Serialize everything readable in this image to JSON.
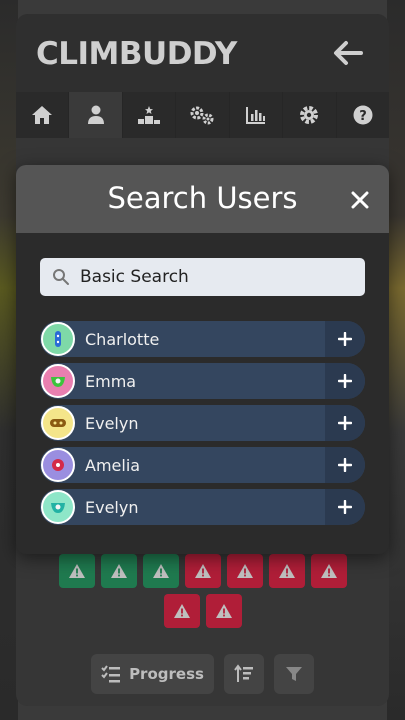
{
  "app": {
    "logo": "CLIMBUDDY"
  },
  "header": {
    "back_icon": "arrow-left-icon"
  },
  "nav": {
    "tabs": [
      {
        "icon": "home-icon"
      },
      {
        "icon": "user-icon",
        "active": true
      },
      {
        "icon": "leaderboard-icon"
      },
      {
        "icon": "gears-icon"
      },
      {
        "icon": "stats-chart-icon"
      },
      {
        "icon": "settings-icon"
      },
      {
        "icon": "help-icon"
      }
    ]
  },
  "modal": {
    "title": "Search Users",
    "close_icon": "close-icon",
    "search": {
      "value": "Basic Search",
      "icon": "search-icon"
    },
    "users": [
      {
        "name": "Charlotte",
        "avatar_color": "#7ed9a8",
        "inner_color": "#2a6bd6"
      },
      {
        "name": "Emma",
        "avatar_color": "#e97fb0",
        "inner_color": "#3cc43c"
      },
      {
        "name": "Evelyn",
        "avatar_color": "#f4e58a",
        "inner_color": "#8a5a12"
      },
      {
        "name": "Amelia",
        "avatar_color": "#9a8ee0",
        "inner_color": "#d42a4a"
      },
      {
        "name": "Evelyn",
        "avatar_color": "#8ee6c8",
        "inner_color": "#22b2a4"
      }
    ]
  },
  "badges": {
    "row1": [
      "green",
      "green",
      "green",
      "red",
      "red",
      "red",
      "red"
    ],
    "row2": [
      "red",
      "red"
    ]
  },
  "bottom": {
    "progress_label": "Progress"
  },
  "colors": {
    "badge_green": "#1f7a4f",
    "badge_red": "#b01e38",
    "user_row": "#34465f"
  }
}
